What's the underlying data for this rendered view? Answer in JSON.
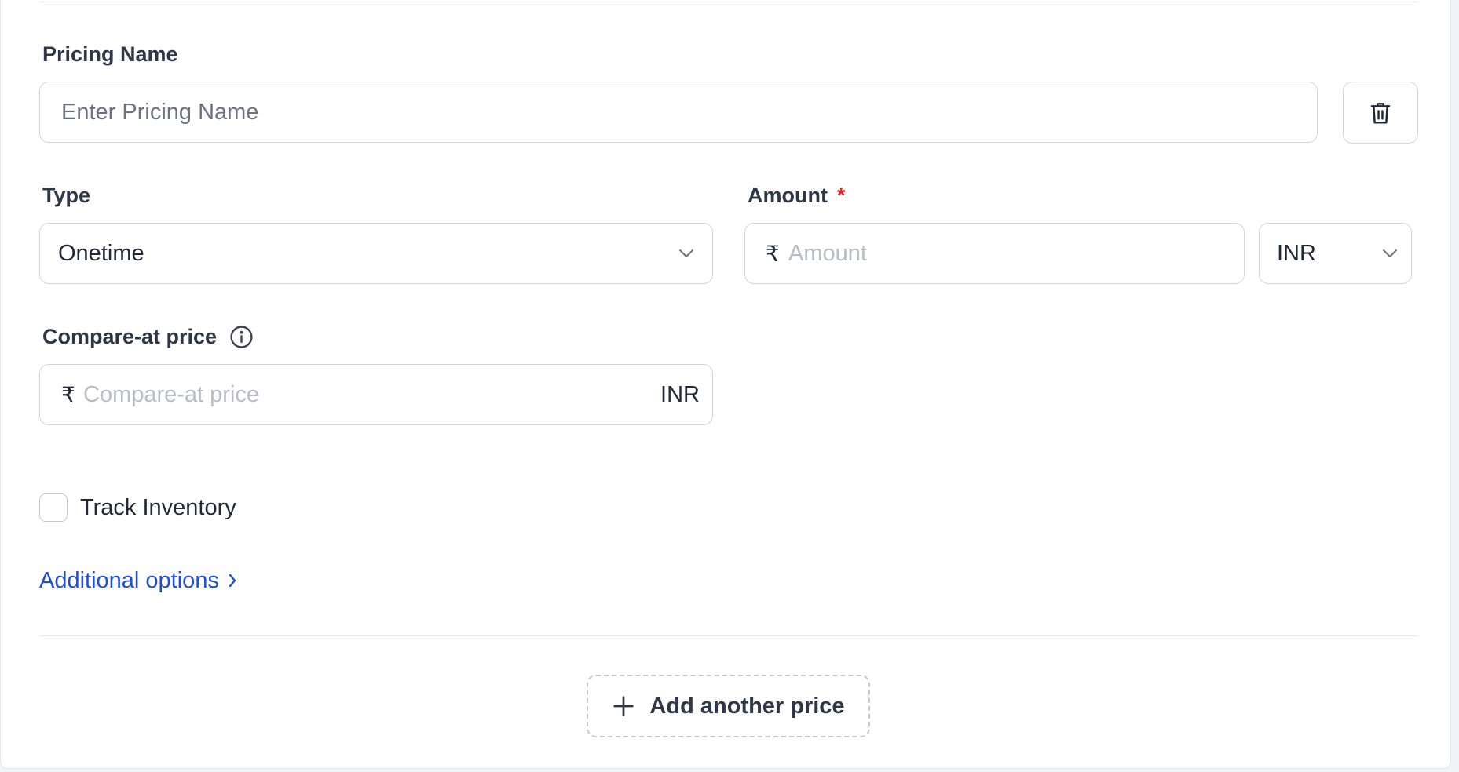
{
  "pricing_name": {
    "label": "Pricing Name",
    "placeholder": "Enter Pricing Name",
    "value": ""
  },
  "delete_button": {
    "icon": "trash-icon"
  },
  "type": {
    "label": "Type",
    "selected": "Onetime"
  },
  "amount": {
    "label": "Amount",
    "required_mark": "*",
    "currency_symbol": "₹",
    "placeholder": "Amount",
    "currency": "INR"
  },
  "compare_at": {
    "label": "Compare-at price",
    "currency_symbol": "₹",
    "placeholder": "Compare-at price",
    "currency": "INR",
    "info_icon": "info-icon"
  },
  "track_inventory": {
    "label": "Track Inventory",
    "checked": false
  },
  "additional_options": {
    "label": "Additional options"
  },
  "add_price": {
    "label": "Add another price"
  },
  "colors": {
    "link": "#1d4ed8",
    "required": "#dc2626",
    "border": "#d1d5db",
    "label": "#2d3748"
  }
}
